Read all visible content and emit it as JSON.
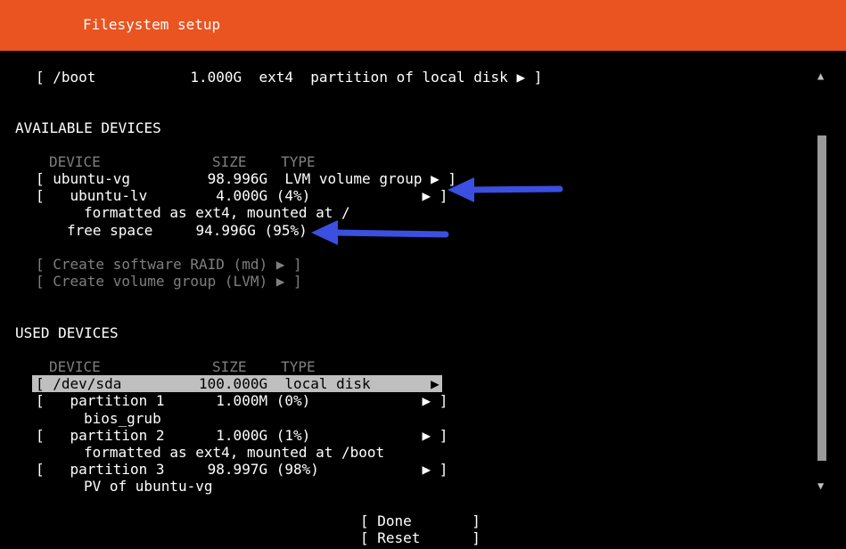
{
  "header": {
    "title": "Filesystem setup"
  },
  "boot_row": "[ /boot           1.000G  ext4  partition of local disk ▶ ]",
  "available": {
    "section_title": "AVAILABLE DEVICES",
    "columns": "DEVICE             SIZE    TYPE",
    "rows": [
      "[ ubuntu-vg         98.996G  LVM volume group ▶ ]",
      "[   ubuntu-lv        4.000G (4%)             ▶ ]",
      "formatted as ext4, mounted at /",
      "free space     94.996G (95%)"
    ],
    "create_raid": "[ Create software RAID (md) ▶ ]",
    "create_lvm": "[ Create volume group (LVM) ▶ ]"
  },
  "used": {
    "section_title": "USED DEVICES",
    "columns": "DEVICE             SIZE    TYPE",
    "rows": [
      "[ /dev/sda         100.000G  local disk       ▶ ]",
      "[   partition 1      1.000M (0%)             ▶ ]",
      "bios_grub",
      "[   partition 2      1.000G (1%)             ▶ ]",
      "formatted as ext4, mounted at /boot",
      "[   partition 3     98.997G (98%)            ▶ ]",
      "PV of ubuntu-vg"
    ]
  },
  "buttons": {
    "done": "[ Done       ]",
    "reset": "[ Reset      ]"
  },
  "scrollbar": {
    "up": "▲",
    "down": "▼"
  },
  "colors": {
    "header_bg": "#e95420",
    "background": "#000000",
    "text": "#ffffff",
    "dim_text": "#7f7f7f",
    "selection_bg": "#bfbfbf",
    "annotation_arrow": "#3b4fe0"
  }
}
